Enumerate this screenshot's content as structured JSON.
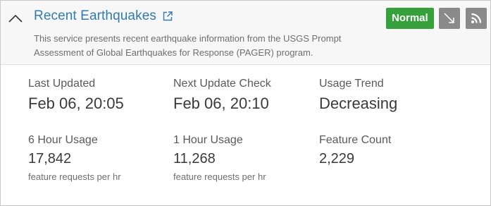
{
  "header": {
    "title": "Recent Earthquakes",
    "description": "This service presents recent earthquake information from the USGS Prompt Assessment of Global Earthquakes for Response (PAGER) program.",
    "status": "Normal",
    "status_color": "#35a13b",
    "icons": [
      "chevron-up-icon",
      "external-link-icon",
      "trend-arrow-down-icon",
      "rss-icon"
    ]
  },
  "stats": {
    "last_updated": {
      "label": "Last Updated",
      "value": "Feb 06, 20:05"
    },
    "next_update": {
      "label": "Next Update Check",
      "value": "Feb 06, 20:10"
    },
    "usage_trend": {
      "label": "Usage Trend",
      "value": "Decreasing"
    },
    "six_hour": {
      "label": "6 Hour Usage",
      "value": "17,842",
      "unit": "feature requests per hr"
    },
    "one_hour": {
      "label": "1 Hour Usage",
      "value": "11,268",
      "unit": "feature requests per hr"
    },
    "feature_count": {
      "label": "Feature Count",
      "value": "2,229"
    }
  }
}
